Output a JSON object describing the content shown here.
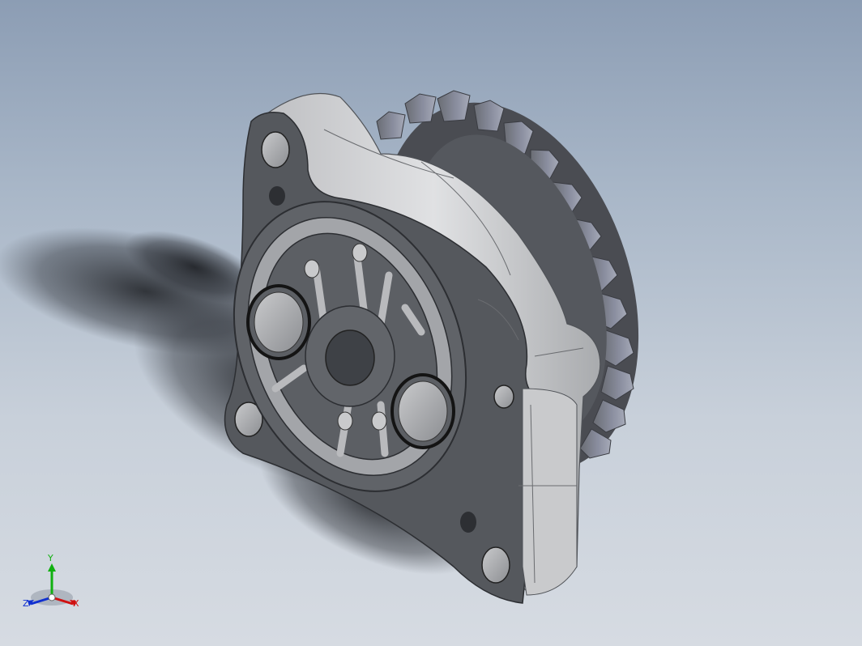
{
  "viewport": {
    "background_top": "#8c9db4",
    "background_bottom": "#d6dbe2"
  },
  "model": {
    "body_color": "#4f5257",
    "face_color": "#5b5e63",
    "highlight_color": "#d2d3d5",
    "gear_color": "#5a5c62",
    "oring_color": "#141414"
  },
  "triad": {
    "x_label": "X",
    "y_label": "Y",
    "z_label": "Z",
    "x_color": "#d01010",
    "y_color": "#10b010",
    "z_color": "#1030d0"
  }
}
